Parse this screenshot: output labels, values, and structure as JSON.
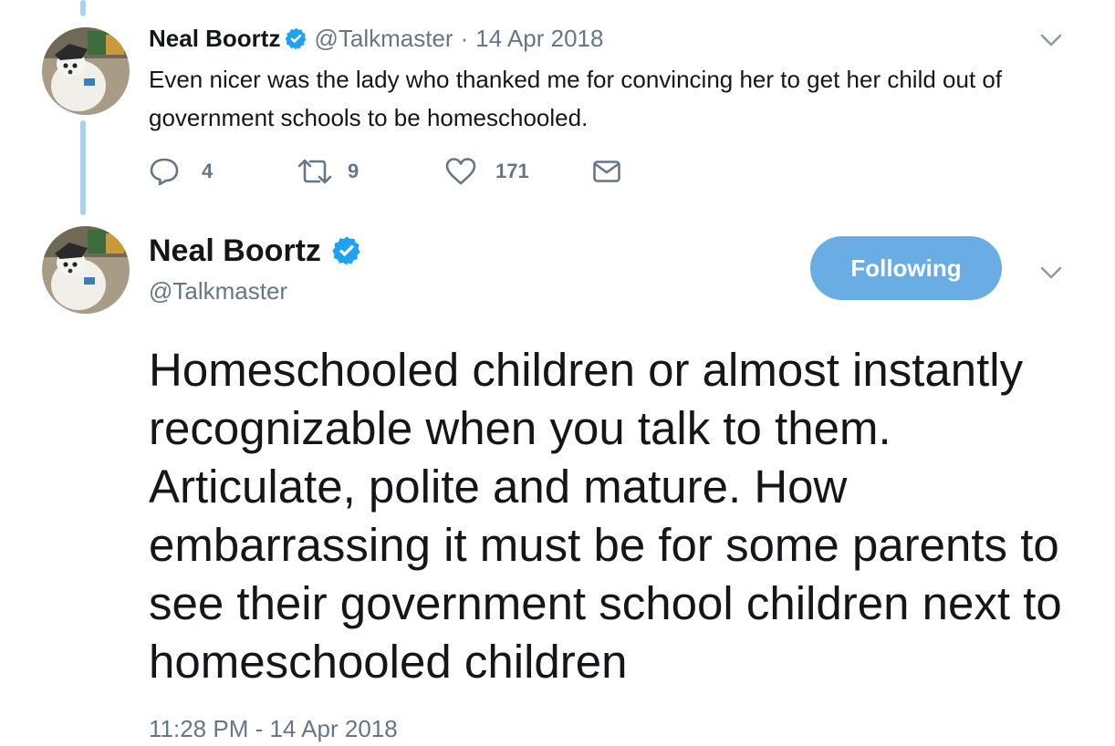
{
  "parent_tweet": {
    "author_name": "Neal Boortz",
    "handle": "@Talkmaster",
    "date": "14 Apr 2018",
    "separator": "·",
    "text": "Even nicer was the lady who thanked me for convincing her to get her child out of government schools to be homeschooled.",
    "actions": {
      "reply_count": "4",
      "retweet_count": "9",
      "like_count": "171"
    }
  },
  "main_tweet": {
    "author_name": "Neal Boortz",
    "handle": "@Talkmaster",
    "follow_label": "Following",
    "text": "Homeschooled children or almost instantly recognizable when you talk to them. Articulate, polite and mature. How embarrassing it must be for some parents to see their government school children next to homeschooled children",
    "timestamp": "11:28 PM - 14 Apr 2018"
  },
  "colors": {
    "accent": "#1da1f2",
    "follow_button": "#6aade4",
    "secondary_text": "#657786",
    "thread_line": "#a9d2ef"
  },
  "icons": {
    "verified": "verified-badge-icon",
    "caret": "chevron-down-icon",
    "reply": "reply-icon",
    "retweet": "retweet-icon",
    "like": "heart-icon",
    "dm": "envelope-icon"
  }
}
